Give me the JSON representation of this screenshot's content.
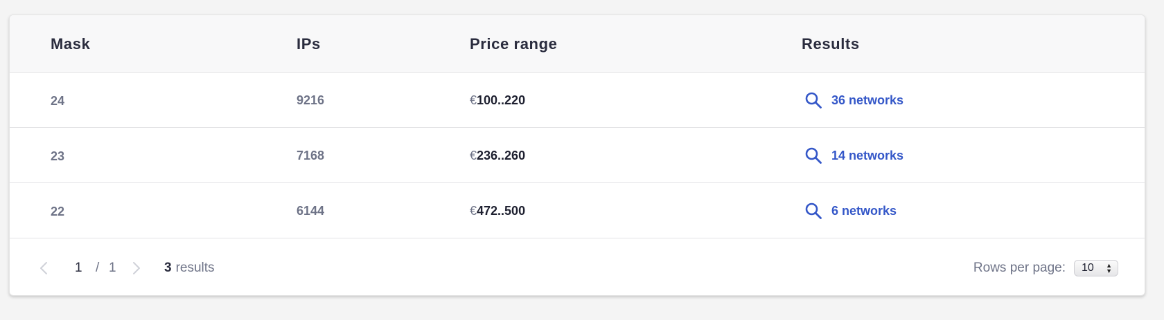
{
  "table": {
    "headers": {
      "mask": "Mask",
      "ips": "IPs",
      "price_range": "Price range",
      "results": "Results"
    },
    "rows": [
      {
        "mask": "24",
        "ips": "9216",
        "currency": "€",
        "price": "100..220",
        "results": "36 networks"
      },
      {
        "mask": "23",
        "ips": "7168",
        "currency": "€",
        "price": "236..260",
        "results": "14 networks"
      },
      {
        "mask": "22",
        "ips": "6144",
        "currency": "€",
        "price": "472..500",
        "results": "6 networks"
      }
    ],
    "result_icon": "search-icon"
  },
  "pagination": {
    "current_page": "1",
    "separator": "/",
    "total_pages": "1",
    "results_count": "3",
    "results_label": "results",
    "rows_per_page_label": "Rows per page:",
    "rows_per_page_value": "10",
    "prev_icon": "chevron-left-icon",
    "next_icon": "chevron-right-icon"
  },
  "colors": {
    "link": "#3457c8",
    "header_bg": "#f8f8f9",
    "page_bg": "#f4f4f4"
  }
}
